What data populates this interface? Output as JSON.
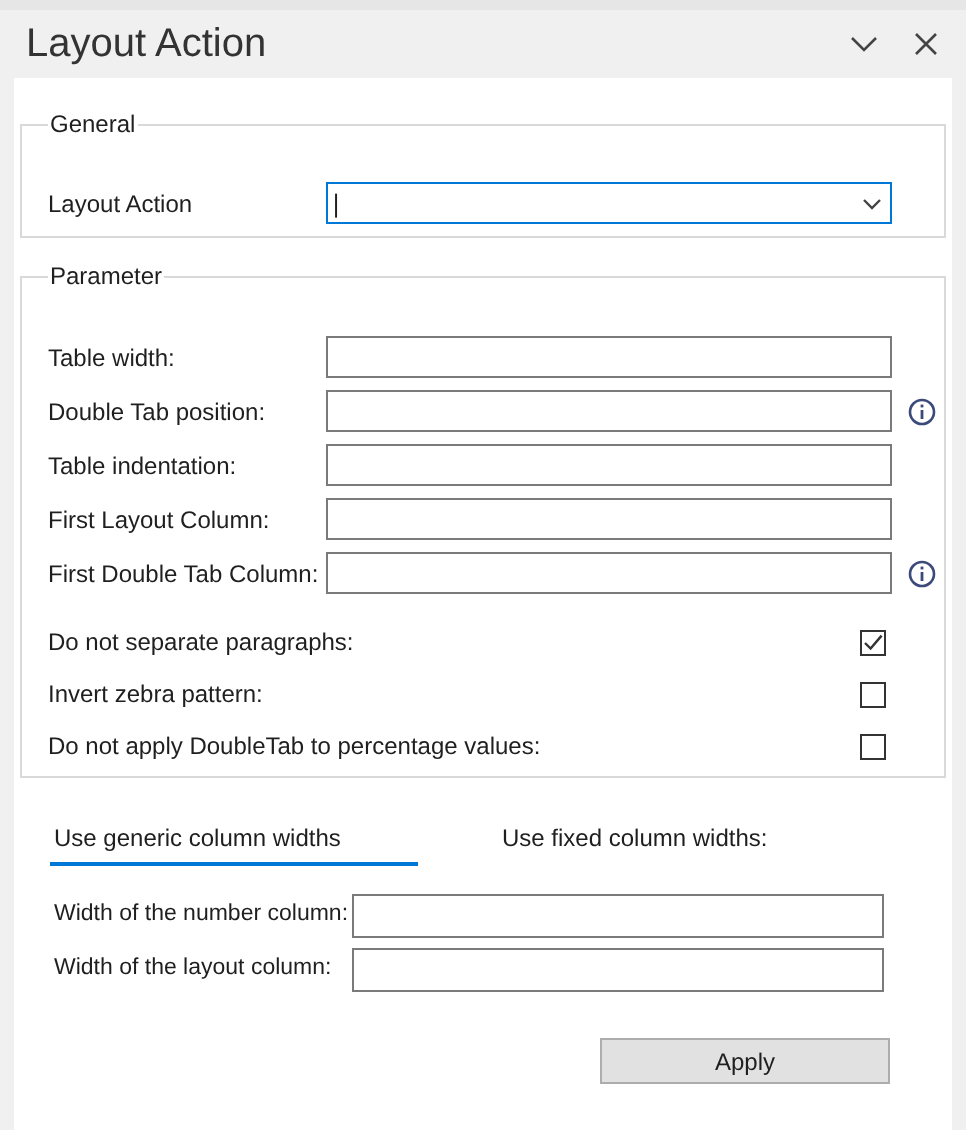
{
  "window": {
    "title": "Layout Action"
  },
  "general": {
    "legend": "General",
    "label": "Layout Action",
    "value": "|"
  },
  "parameter": {
    "legend": "Parameter",
    "rows": [
      {
        "kind": "field",
        "label": "Table width:",
        "info": false
      },
      {
        "kind": "field",
        "label": "Double Tab position:",
        "info": true
      },
      {
        "kind": "field",
        "label": "Table indentation:",
        "info": false
      },
      {
        "kind": "field",
        "label": "First Layout Column:",
        "info": false
      },
      {
        "kind": "field",
        "label": "First Double Tab Column:",
        "info": true
      },
      {
        "kind": "checkbox",
        "label": "Do not separate paragraphs:",
        "checked": true
      },
      {
        "kind": "checkbox",
        "label": "Invert zebra pattern:",
        "checked": false
      },
      {
        "kind": "checkbox",
        "label": "Do not apply DoubleTab to percentage values:",
        "checked": false
      }
    ]
  },
  "tabs": [
    {
      "label": "Use generic column widths",
      "selected": true
    },
    {
      "label": "Use fixed column widths:",
      "selected": false
    }
  ],
  "widths": [
    {
      "label": "Width of the number column:"
    },
    {
      "label": "Width of the layout column:"
    }
  ],
  "apply_button": "Apply"
}
